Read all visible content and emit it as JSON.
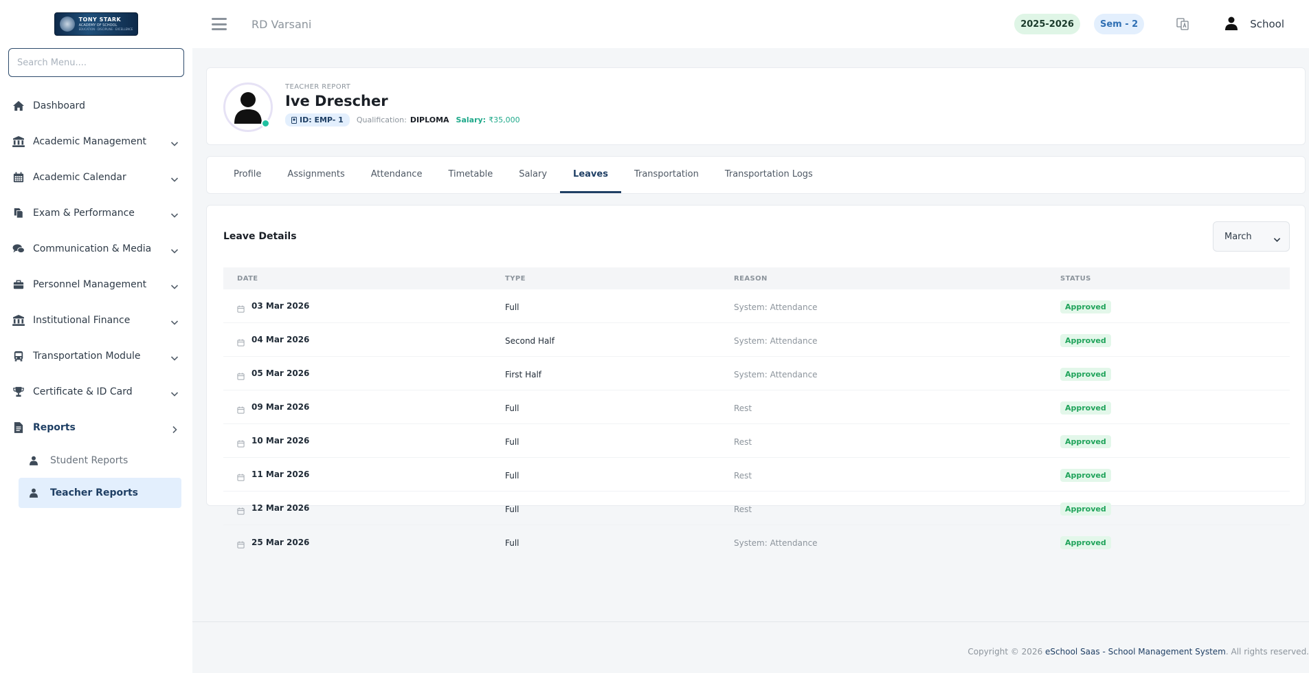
{
  "logo": {
    "line1": "TONY STARK",
    "line2": "ACADEMY OF SCHOOL",
    "line3": "EDUCATION · DISCIPLINE · EXCELLENCE"
  },
  "sidebar": {
    "search_placeholder": "Search Menu....",
    "items": [
      {
        "label": "Dashboard",
        "icon": "home-icon"
      },
      {
        "label": "Academic Management",
        "icon": "institution-icon"
      },
      {
        "label": "Academic Calendar",
        "icon": "calendar-icon"
      },
      {
        "label": "Exam & Performance",
        "icon": "documents-icon"
      },
      {
        "label": "Communication & Media",
        "icon": "chat-icon"
      },
      {
        "label": "Personnel Management",
        "icon": "briefcase-icon"
      },
      {
        "label": "Institutional Finance",
        "icon": "bank-icon"
      },
      {
        "label": "Transportation Module",
        "icon": "bus-icon"
      },
      {
        "label": "Certificate & ID Card",
        "icon": "trophy-icon"
      },
      {
        "label": "Reports",
        "icon": "report-icon"
      }
    ],
    "sub_items": [
      {
        "label": "Student Reports",
        "icon": "user-icon"
      },
      {
        "label": "Teacher Reports",
        "icon": "user-icon"
      }
    ]
  },
  "topbar": {
    "school_name": "RD Varsani",
    "session": "2025-2026",
    "semester": "Sem - 2",
    "user_name": "School"
  },
  "profile": {
    "role": "TEACHER REPORT",
    "name": "Ive Drescher",
    "id": "ID: EMP- 1",
    "qualification_label": "Qualification:",
    "qualification": "DIPLOMA",
    "salary_label": "Salary:",
    "salary": "₹35,000"
  },
  "tabs": [
    {
      "label": "Profile"
    },
    {
      "label": "Assignments"
    },
    {
      "label": "Attendance"
    },
    {
      "label": "Timetable"
    },
    {
      "label": "Salary"
    },
    {
      "label": "Leaves"
    },
    {
      "label": "Transportation"
    },
    {
      "label": "Transportation Logs"
    }
  ],
  "active_tab": "Leaves",
  "leave": {
    "title": "Leave Details",
    "month": "March",
    "headers": {
      "date": "DATE",
      "type": "TYPE",
      "reason": "REASON",
      "status": "STATUS"
    },
    "rows": [
      {
        "date": "03 Mar 2026",
        "type": "Full",
        "reason": "System: Attendance",
        "status": "Approved"
      },
      {
        "date": "04 Mar 2026",
        "type": "Second Half",
        "reason": "System: Attendance",
        "status": "Approved"
      },
      {
        "date": "05 Mar 2026",
        "type": "First Half",
        "reason": "System: Attendance",
        "status": "Approved"
      },
      {
        "date": "09 Mar 2026",
        "type": "Full",
        "reason": "Rest",
        "status": "Approved"
      },
      {
        "date": "10 Mar 2026",
        "type": "Full",
        "reason": "Rest",
        "status": "Approved"
      },
      {
        "date": "11 Mar 2026",
        "type": "Full",
        "reason": "Rest",
        "status": "Approved"
      },
      {
        "date": "12 Mar 2026",
        "type": "Full",
        "reason": "Rest",
        "status": "Approved"
      },
      {
        "date": "25 Mar 2026",
        "type": "Full",
        "reason": "System: Attendance",
        "status": "Approved"
      }
    ]
  },
  "footer": {
    "prefix": "Copyright © 2026 ",
    "brand": "eSchool Saas - School Management System",
    "suffix": ". All rights reserved."
  },
  "colors": {
    "accent": "#1f3f64",
    "approved": "#1fa35a",
    "salary": "#1fa98a",
    "active_bg": "#e3effd"
  }
}
